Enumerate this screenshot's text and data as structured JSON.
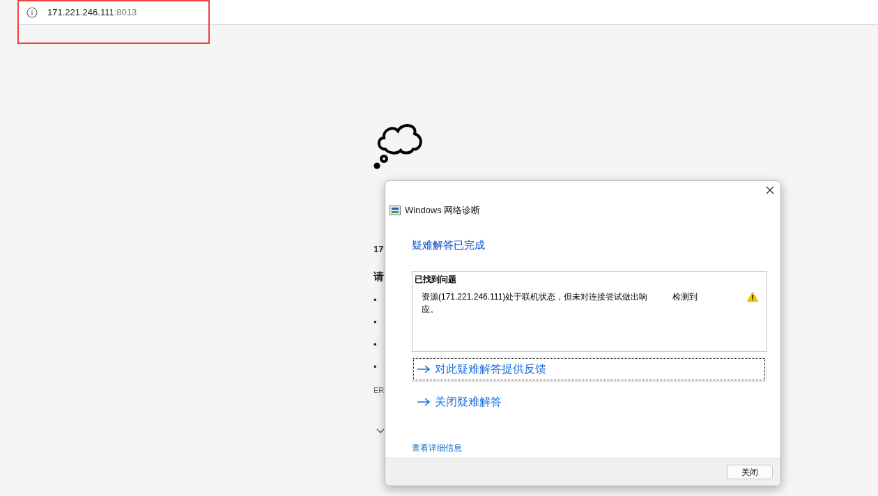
{
  "browser": {
    "address_host": "171.221.246.111",
    "address_port": ":8013"
  },
  "error_page": {
    "line_1": "17",
    "line_2": "请",
    "bullets": [
      "•",
      "•",
      "•",
      "•"
    ],
    "code": "ER"
  },
  "dialog": {
    "title": "Windows 网络诊断",
    "heading": "疑难解答已完成",
    "problems_title": "已找到问题",
    "problems": [
      {
        "description": "资源(171.221.246.111)处于联机状态，但未对连接尝试做出响应。",
        "status": "检测到",
        "kind": "warning"
      }
    ],
    "actions": [
      {
        "label": "对此疑难解答提供反馈",
        "focused": true
      },
      {
        "label": "关闭疑难解答",
        "focused": false
      }
    ],
    "details_link": "查看详细信息",
    "button": "关闭"
  }
}
